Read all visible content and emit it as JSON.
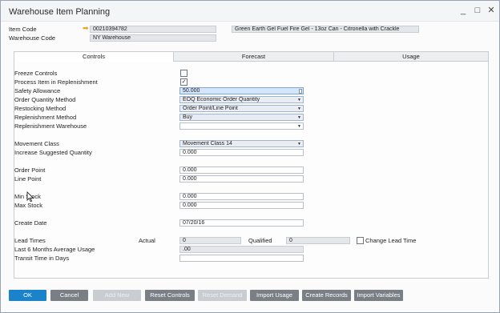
{
  "window": {
    "title": "Warehouse Item Planning",
    "minimize": "_",
    "maximize": "□",
    "close": "✕"
  },
  "header": {
    "item_code_label": "Item Code",
    "item_code_value": "00210394782",
    "item_description": "Green Earth Gel Fuel Fire Gel - 13oz Can - Citronella with Crackle",
    "warehouse_code_label": "Warehouse Code",
    "warehouse_code_value": "NY Warehouse"
  },
  "tabs": [
    {
      "label": "Controls"
    },
    {
      "label": "Forecast"
    },
    {
      "label": "Usage"
    }
  ],
  "controls": {
    "freeze_controls": {
      "label": "Freeze Controls",
      "checked": ""
    },
    "process_item": {
      "label": "Process Item in Replenishment",
      "checked": "✓"
    },
    "safety_allowance": {
      "label": "Safety Allowance",
      "value": "50.000"
    },
    "order_quantity_method": {
      "label": "Order Quantity Method",
      "value": "EOQ Economic Order Quantity"
    },
    "restocking_method": {
      "label": "Restocking Method",
      "value": "Order Point/Line Point"
    },
    "replenishment_method": {
      "label": "Replenishment Method",
      "value": "Buy"
    },
    "replenishment_warehouse": {
      "label": "Replenishment Warehouse",
      "value": ""
    },
    "movement_class": {
      "label": "Movement Class",
      "value": "Movement Class 14"
    },
    "increase_suggested_quantity": {
      "label": "Increase Suggested Quantity",
      "value": "0.000"
    },
    "order_point": {
      "label": "Order Point",
      "value": "0.000"
    },
    "line_point": {
      "label": "Line Point",
      "value": "0.000"
    },
    "min_stock": {
      "label": "Min Stock",
      "value": "0.000"
    },
    "max_stock": {
      "label": "Max Stock",
      "value": "0.000"
    },
    "create_date": {
      "label": "Create Date",
      "value": "07/20/16"
    },
    "lead_times": {
      "label": "Lead Times",
      "actual_label": "Actual",
      "actual_value": "0",
      "qualified_label": "Qualified",
      "qualified_value": "0",
      "change_lead_time_label": "Change Lead Time",
      "change_lead_time_checked": ""
    },
    "last6_avg_usage": {
      "label": "Last 6 Months Average Usage",
      "value": ".00"
    },
    "transit_time": {
      "label": "Transit Time in Days",
      "value": ""
    }
  },
  "buttons": {
    "ok": "OK",
    "cancel": "Cancel",
    "add_new": "Add New",
    "reset_controls": "Reset Controls",
    "reset_demand": "Reset Demand",
    "import_usage": "Import Usage",
    "create_records": "Create Records",
    "import_variables": "Import Variables"
  },
  "icons": {
    "link_arrow": "arrow-right-icon",
    "dropdown": "chevron-down-icon",
    "cursor": "mouse-pointer-icon"
  },
  "colors": {
    "primary_button": "#1a83c9",
    "secondary_button": "#7a7f86",
    "disabled_button": "#c9ccd0",
    "link_arrow": "#e8a317",
    "highlight_field": "#d4e6fb"
  }
}
